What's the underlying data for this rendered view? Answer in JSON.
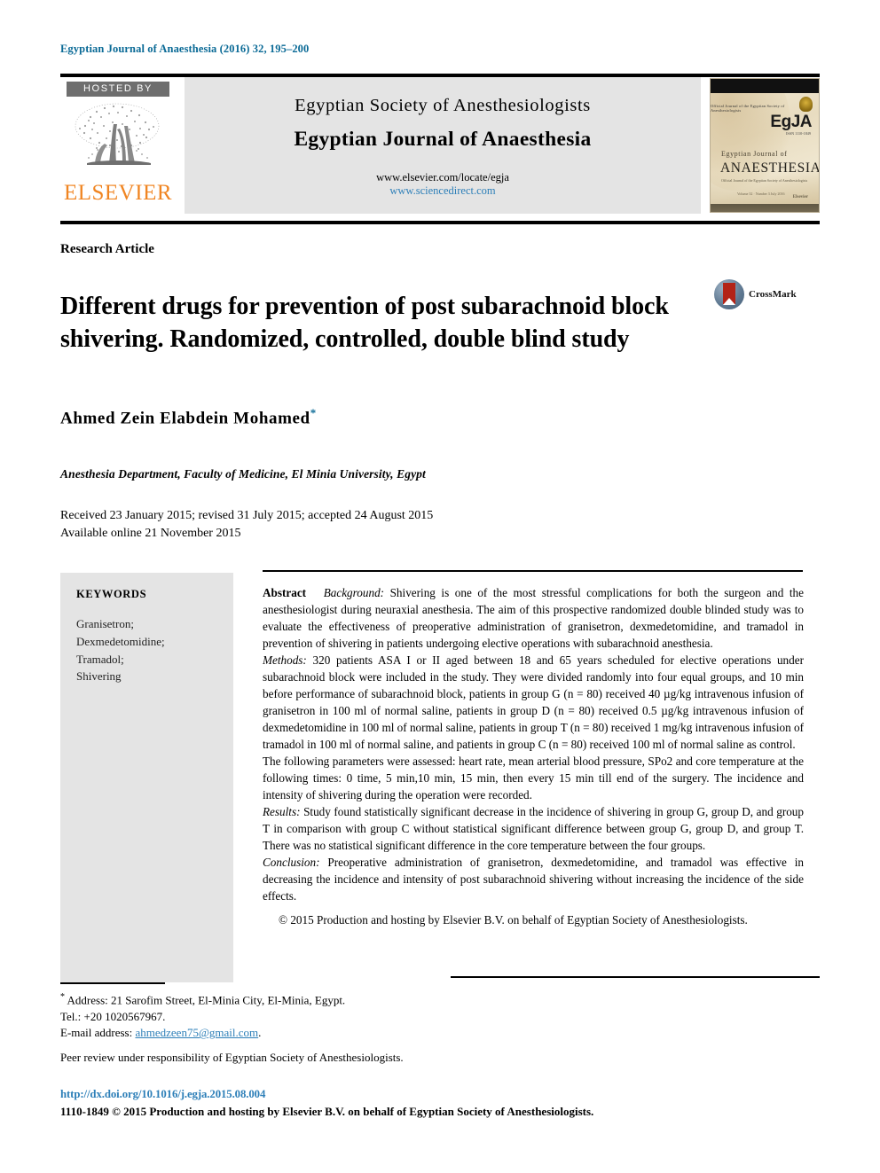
{
  "running_head": "Egyptian Journal of Anaesthesia (2016) 32, 195–200",
  "masthead": {
    "hosted_by": "HOSTED BY",
    "publisher": "ELSEVIER",
    "society": "Egyptian Society of Anesthesiologists",
    "journal": "Egyptian Journal of Anaesthesia",
    "url_locate": "www.elsevier.com/locate/egja",
    "url_sciencedirect": "www.sciencedirect.com",
    "cover": {
      "logo": "EgJA",
      "logo_sub": "Official Journal of the Egyptian Society of Anesthesiologists",
      "logo_sub2": "ISSN 1110-1849",
      "line1": "Egyptian Journal of",
      "line2": "ANAESTHESIA",
      "tiny": "Official Journal of the\nEgyptian Society of\nAnesthesiologists",
      "volume": "Volume 32 · Number 3\nJuly 2016",
      "publisher": "Elsevier"
    }
  },
  "article": {
    "type": "Research Article",
    "title": "Different drugs for prevention of post subarachnoid block shivering. Randomized, controlled, double blind study",
    "crossmark_label": "CrossMark",
    "author": "Ahmed Zein Elabdein Mohamed",
    "author_marker": "*",
    "affiliation": "Anesthesia Department, Faculty of Medicine, El Minia University, Egypt",
    "received_line": "Received 23 January 2015; revised 31 July 2015; accepted 24 August 2015",
    "available_line": "Available online 21 November 2015"
  },
  "keywords": {
    "heading": "KEYWORDS",
    "items": "Granisetron;\nDexmedetomidine;\nTramadol;\nShivering"
  },
  "abstract": {
    "label": "Abstract",
    "background_label": "Background:",
    "background_text": " Shivering is one of the most stressful complications for both the surgeon and the anesthesiologist during neuraxial anesthesia. The aim of this prospective randomized double blinded study was to evaluate the effectiveness of preoperative administration of granisetron, dexmedetomidine, and tramadol in prevention of shivering in patients undergoing elective operations with subarachnoid anesthesia.",
    "methods_label": "Methods:",
    "methods_text": " 320 patients ASA I or II aged between 18 and 65 years scheduled for elective operations under subarachnoid block were included in the study. They were divided randomly into four equal groups, and 10 min before performance of subarachnoid block, patients in group G (n = 80) received 40 µg/kg intravenous infusion of granisetron in 100 ml of normal saline, patients in group D (n = 80) received 0.5 µg/kg intravenous infusion of dexmedetomidine in 100 ml of normal saline, patients in group T (n = 80) received 1 mg/kg intravenous infusion of tramadol in 100 ml of normal saline, and patients in group C (n = 80) received 100 ml of normal saline as control.",
    "parameters_text": "The following parameters were assessed: heart rate, mean arterial blood pressure, SPo2 and core temperature at the following times: 0 time, 5 min,10 min, 15 min, then every 15 min till end of the surgery. The incidence and intensity of shivering during the operation were recorded.",
    "results_label": "Results:",
    "results_text": " Study found statistically significant decrease in the incidence of shivering in group G, group D, and group T in comparison with group C without statistical significant difference between group G, group D, and group T. There was no statistical significant difference in the core temperature between the four groups.",
    "conclusion_label": "Conclusion:",
    "conclusion_text": " Preoperative administration of granisetron, dexmedetomidine, and tramadol was effective in decreasing the incidence and intensity of post subarachnoid shivering without increasing the incidence of the side effects.",
    "copyright": "© 2015 Production and hosting by Elsevier B.V. on behalf of Egyptian Society of Anesthesiologists."
  },
  "footnotes": {
    "address": " Address: 21 Sarofim Street, El-Minia City, El-Minia, Egypt.",
    "tel": "Tel.: +20 1020567967.",
    "email_label": "E-mail address: ",
    "email": "ahmedzeen75@gmail.com",
    "email_suffix": ".",
    "peer_review": "Peer review under responsibility of Egyptian Society of Anesthesiologists.",
    "doi": "http://dx.doi.org/10.1016/j.egja.2015.08.004",
    "issn_line": "1110-1849 © 2015 Production and hosting by Elsevier B.V. on behalf of Egyptian Society of Anesthesiologists."
  },
  "colors": {
    "link": "#2d7fb8",
    "running_head": "#0a6a96",
    "elsevier_orange": "#F08522",
    "panel_gray": "#e4e4e4"
  }
}
